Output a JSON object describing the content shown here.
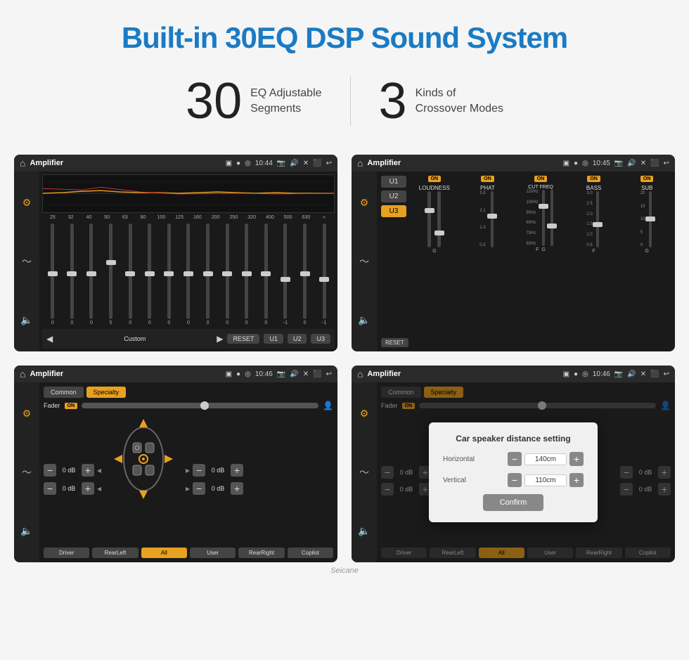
{
  "page": {
    "title": "Built-in 30EQ DSP Sound System",
    "stat1_number": "30",
    "stat1_label1": "EQ Adjustable",
    "stat1_label2": "Segments",
    "stat2_number": "3",
    "stat2_label1": "Kinds of",
    "stat2_label2": "Crossover Modes"
  },
  "screen1": {
    "title": "Amplifier",
    "time": "10:44",
    "freq_labels": [
      "25",
      "32",
      "40",
      "50",
      "63",
      "80",
      "100",
      "125",
      "160",
      "200",
      "250",
      "320",
      "400",
      "500",
      "630"
    ],
    "slider_values": [
      "0",
      "0",
      "0",
      "5",
      "0",
      "0",
      "0",
      "0",
      "0",
      "0",
      "0",
      "0",
      "-1",
      "0",
      "-1"
    ],
    "mode_label": "Custom",
    "buttons": {
      "reset": "RESET",
      "u1": "U1",
      "u2": "U2",
      "u3": "U3"
    }
  },
  "screen2": {
    "title": "Amplifier",
    "time": "10:45",
    "presets": [
      "U1",
      "U2",
      "U3"
    ],
    "active_preset": "U3",
    "channels": [
      {
        "name": "LOUDNESS",
        "on": true
      },
      {
        "name": "PHAT",
        "on": true
      },
      {
        "name": "CUT FREQ",
        "on": true
      },
      {
        "name": "BASS",
        "on": true
      },
      {
        "name": "SUB",
        "on": true
      }
    ],
    "reset_label": "RESET"
  },
  "screen3": {
    "title": "Amplifier",
    "time": "10:46",
    "tabs": [
      "Common",
      "Specialty"
    ],
    "active_tab": "Specialty",
    "fader_label": "Fader",
    "fader_on": "ON",
    "db_rows": [
      {
        "label": "0 dB",
        "side": "left"
      },
      {
        "label": "0 dB",
        "side": "left"
      },
      {
        "label": "0 dB",
        "side": "right"
      },
      {
        "label": "0 dB",
        "side": "right"
      }
    ],
    "bottom_btns": [
      "Driver",
      "RearLeft",
      "All",
      "User",
      "RearRight",
      "Copilot"
    ],
    "active_btn": "All"
  },
  "screen4": {
    "title": "Amplifier",
    "time": "10:46",
    "tabs": [
      "Common",
      "Specialty"
    ],
    "active_tab": "Specialty",
    "dialog": {
      "title": "Car speaker distance setting",
      "horizontal_label": "Horizontal",
      "horizontal_value": "140cm",
      "vertical_label": "Vertical",
      "vertical_value": "110cm",
      "confirm_label": "Confirm"
    },
    "bottom_btns": [
      "Driver",
      "RearLeft",
      "All",
      "User",
      "RearRight",
      "Copilot"
    ]
  },
  "watermark": "Seicane"
}
